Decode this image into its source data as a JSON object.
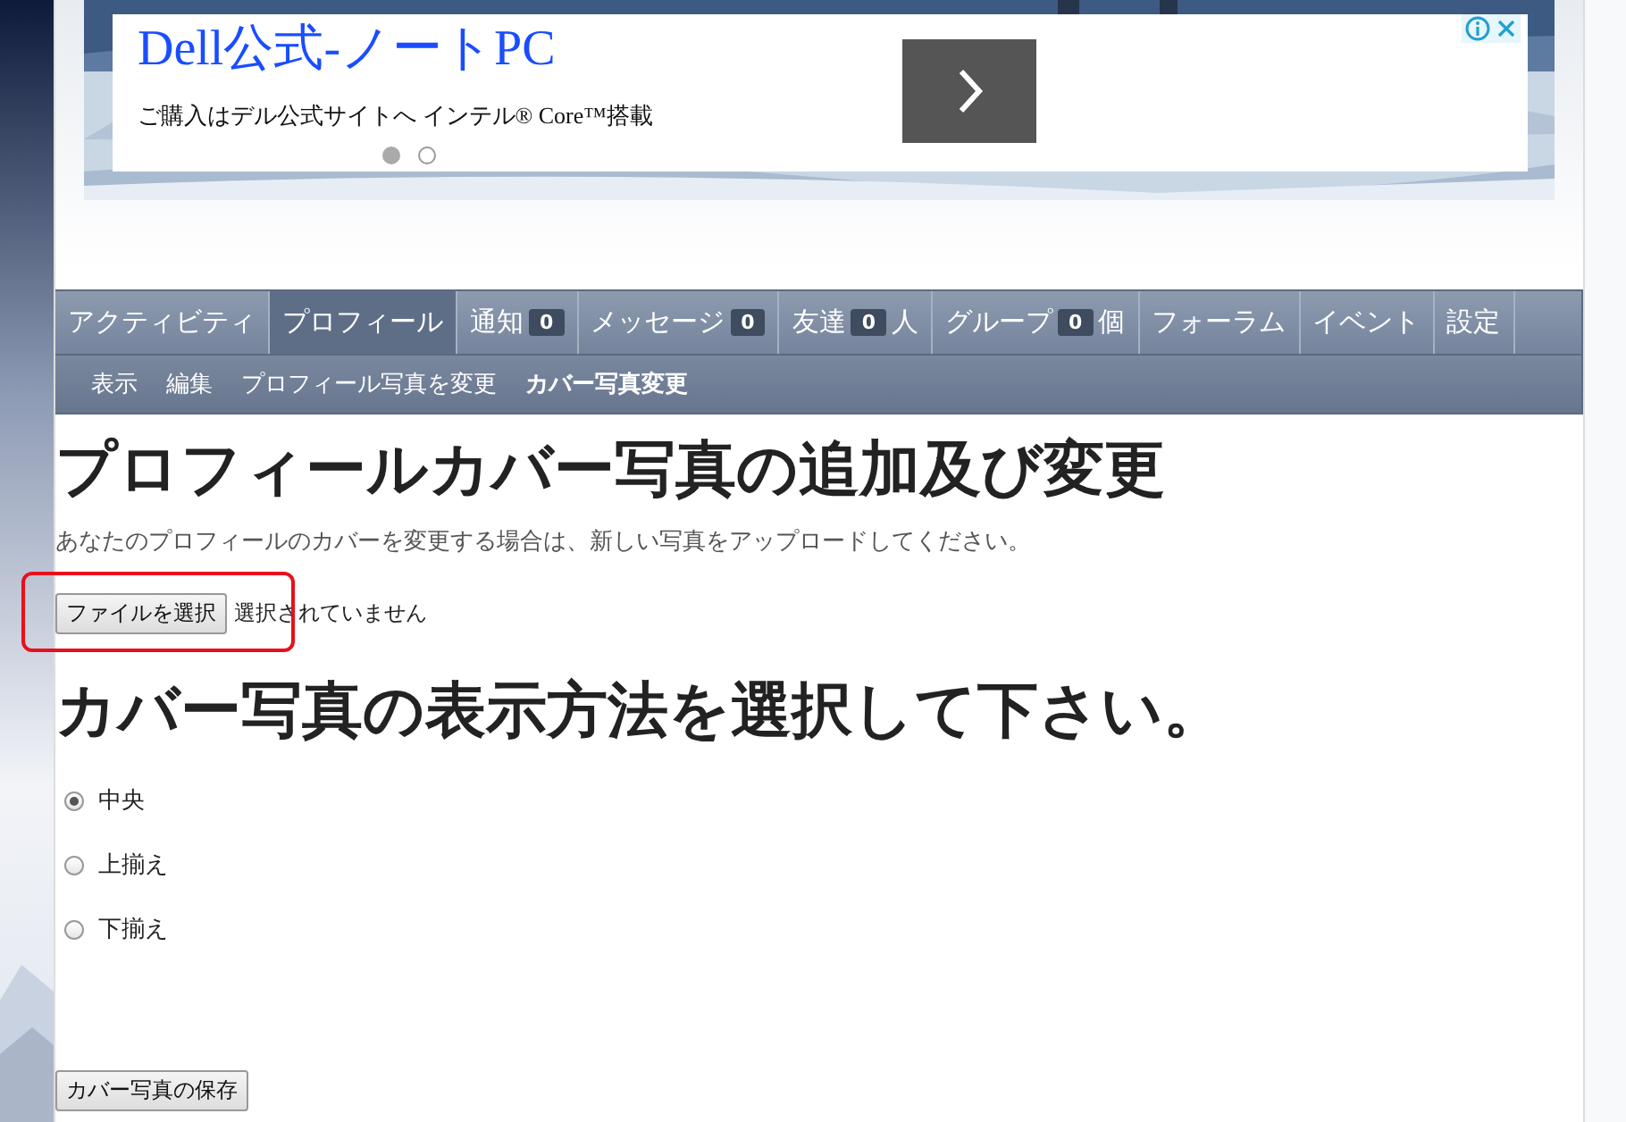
{
  "ad": {
    "title": "Dell公式-ノートPC",
    "text": "ご購入はデル公式サイトへ インテル® Core™搭載",
    "dots": [
      {
        "selected": true
      },
      {
        "selected": false
      }
    ]
  },
  "nav": {
    "tabs": [
      {
        "label": "アクティビティ",
        "selected": false
      },
      {
        "label": "プロフィール",
        "selected": true
      },
      {
        "label": "通知",
        "count": "0",
        "selected": false
      },
      {
        "label": "メッセージ",
        "count": "0",
        "selected": false
      },
      {
        "label": "友達",
        "count": "0",
        "suffix": "人",
        "selected": false
      },
      {
        "label": "グループ",
        "count": "0",
        "suffix": "個",
        "selected": false
      },
      {
        "label": "フォーラム",
        "selected": false
      },
      {
        "label": "イベント",
        "selected": false
      },
      {
        "label": "設定",
        "selected": false
      }
    ],
    "subtabs": [
      {
        "label": "表示",
        "selected": false
      },
      {
        "label": "編集",
        "selected": false
      },
      {
        "label": "プロフィール写真を変更",
        "selected": false
      },
      {
        "label": "カバー写真変更",
        "selected": true
      }
    ]
  },
  "heading": "プロフィールカバー写真の追加及び変更",
  "description": "あなたのプロフィールのカバーを変更する場合は、新しい写真をアップロードしてください。",
  "file_button": "ファイルを選択",
  "file_status": "選択されていません",
  "heading2": "カバー写真の表示方法を選択して下さい。",
  "options": [
    {
      "label": "中央",
      "selected": true
    },
    {
      "label": "上揃え",
      "selected": false
    },
    {
      "label": "下揃え",
      "selected": false
    }
  ],
  "save_button": "カバー写真の保存"
}
